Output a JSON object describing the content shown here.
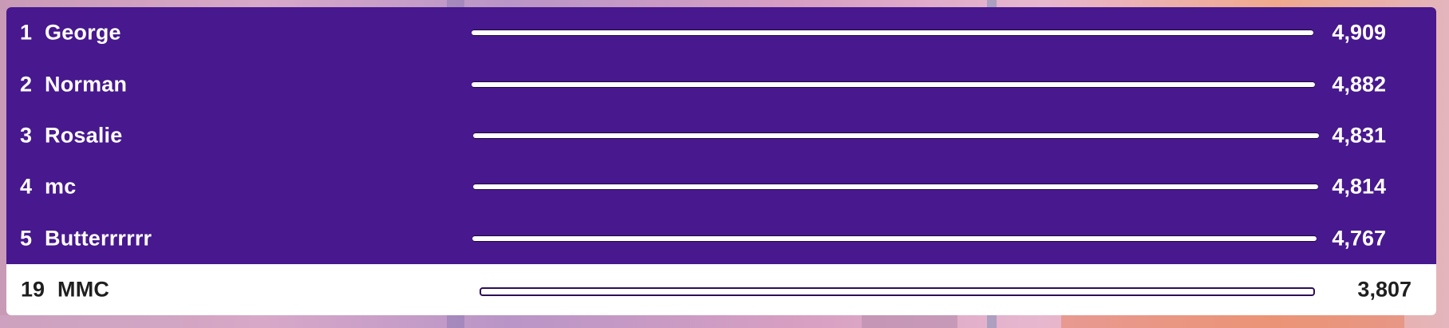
{
  "leaderboard": {
    "top": [
      {
        "rank": "1",
        "name": "George",
        "score": "4,909"
      },
      {
        "rank": "2",
        "name": "Norman",
        "score": "4,882"
      },
      {
        "rank": "3",
        "name": "Rosalie",
        "score": "4,831"
      },
      {
        "rank": "4",
        "name": "mc",
        "score": "4,814"
      },
      {
        "rank": "5",
        "name": "Butterrrrrr",
        "score": "4,767"
      }
    ],
    "current_player": {
      "rank": "19",
      "name": "MMC",
      "score": "3,807"
    }
  },
  "colors": {
    "top_rows_background": "#47188e",
    "current_player_background": "#ffffff",
    "top_text": "#ffffff",
    "current_player_text": "#1f1f1f"
  }
}
